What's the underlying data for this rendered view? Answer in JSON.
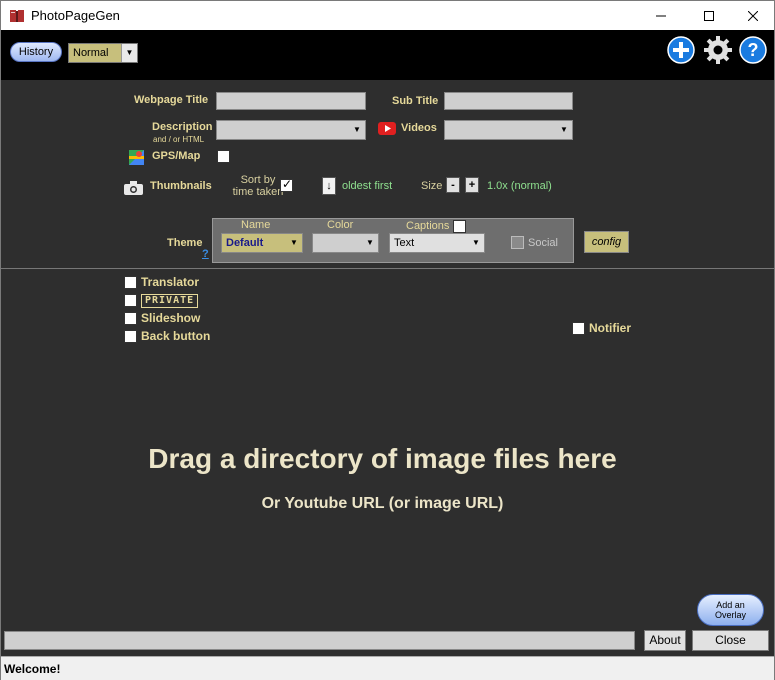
{
  "window": {
    "title": "PhotoPageGen",
    "controls": [
      "minimize-icon",
      "maximize-icon",
      "close-icon"
    ]
  },
  "topbar": {
    "history_label": "History",
    "mode_value": "Normal",
    "icons": [
      "plus-icon",
      "gear-icon",
      "help-icon"
    ]
  },
  "form": {
    "webpage_title_label": "Webpage Title",
    "webpage_title_value": "",
    "subtitle_label": "Sub Title",
    "subtitle_value": "",
    "description_label": "Description",
    "description_sublabel": "and / or HTML",
    "description_value": "",
    "videos_label": "Videos",
    "videos_value": "",
    "gps_label": "GPS/Map",
    "gps_checked": false,
    "thumbnails_label": "Thumbnails",
    "sort_label_line1": "Sort by",
    "sort_label_line2": "time taken",
    "sort_checked": true,
    "order_arrow": "↓",
    "order_label": "oldest first",
    "size_label": "Size",
    "size_minus": "-",
    "size_plus": "+",
    "size_value": "1.0x (normal)",
    "theme_label": "Theme",
    "theme_help": "?"
  },
  "theme_panel": {
    "name_header": "Name",
    "color_header": "Color",
    "captions_header": "Captions",
    "name_value": "Default",
    "color_value": "",
    "captions_value": "Text",
    "captions_checked": false,
    "social_label": "Social",
    "social_checked": false,
    "config_label": "config"
  },
  "options": {
    "translator_label": "Translator",
    "private_label": "PRIVATE",
    "slideshow_label": "Slideshow",
    "back_button_label": "Back button",
    "notifier_label": "Notifier"
  },
  "dropzone": {
    "main_text": "Drag a directory of image files here",
    "sub_text": "Or Youtube URL (or image URL)"
  },
  "footer": {
    "overlay_line1": "Add an",
    "overlay_line2": "Overlay",
    "about_label": "About",
    "close_label": "Close",
    "status_text": "Welcome!"
  },
  "colors": {
    "background": "#2e2e2e",
    "label_gold": "#e6d99a",
    "green_text": "#8fe08f",
    "accent_blue": "#1a7be0"
  }
}
